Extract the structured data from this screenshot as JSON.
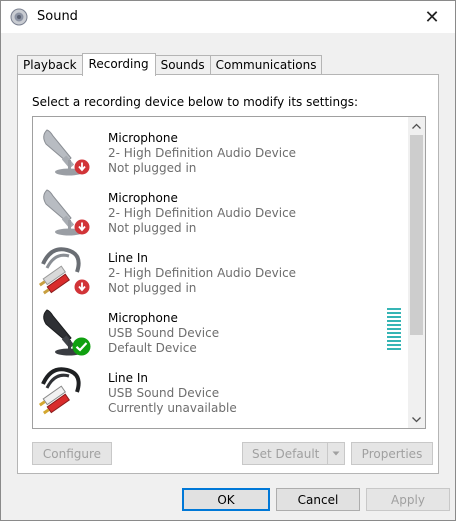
{
  "window": {
    "title": "Sound",
    "close_glyph": "✕"
  },
  "tabs": [
    {
      "label": "Playback",
      "active": false
    },
    {
      "label": "Recording",
      "active": true
    },
    {
      "label": "Sounds",
      "active": false
    },
    {
      "label": "Communications",
      "active": false
    }
  ],
  "panel": {
    "instruction": "Select a recording device below to modify its settings:",
    "devices": [
      {
        "name": "Microphone",
        "description": "2- High Definition Audio Device",
        "status": "Not plugged in",
        "icon": "microphone-icon",
        "badge": "unplugged-badge-icon"
      },
      {
        "name": "Microphone",
        "description": "2- High Definition Audio Device",
        "status": "Not plugged in",
        "icon": "microphone-icon",
        "badge": "unplugged-badge-icon"
      },
      {
        "name": "Line In",
        "description": "2- High Definition Audio Device",
        "status": "Not plugged in",
        "icon": "line-in-icon",
        "badge": "unplugged-badge-icon"
      },
      {
        "name": "Microphone",
        "description": "USB Sound Device",
        "status": "Default Device",
        "icon": "microphone-icon",
        "badge": "default-check-badge-icon"
      },
      {
        "name": "Line In",
        "description": "USB Sound Device",
        "status": "Currently unavailable",
        "icon": "line-in-icon",
        "badge": ""
      }
    ],
    "buttons": {
      "configure": "Configure",
      "set_default": "Set Default",
      "properties": "Properties"
    }
  },
  "footer": {
    "ok": "OK",
    "cancel": "Cancel",
    "apply": "Apply"
  },
  "colors": {
    "accent": "#0078d7",
    "badge_red": "#d13438",
    "badge_green": "#10a010",
    "level_meter": "#36b5b5"
  }
}
